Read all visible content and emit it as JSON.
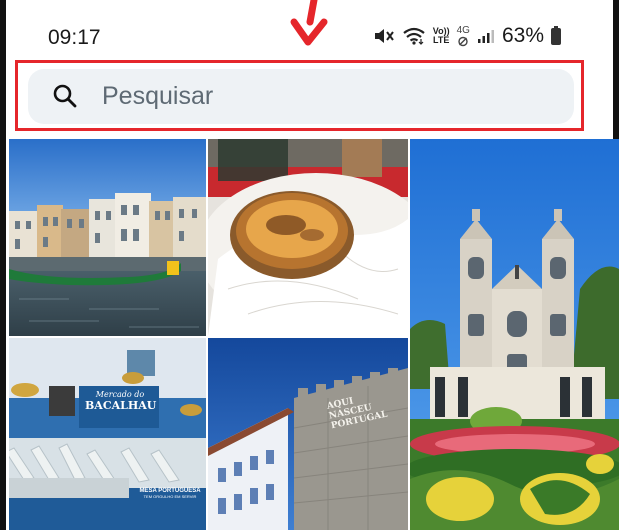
{
  "status_bar": {
    "time": "09:17",
    "volte_top": "Vo))",
    "volte_bottom": "LTE",
    "network_top": "4G",
    "battery_percent": "63%",
    "icons": [
      "mute-icon",
      "wifi-icon",
      "volte-icon",
      "no-data-icon",
      "signal-icon",
      "battery-icon"
    ]
  },
  "search": {
    "placeholder": "Pesquisar",
    "highlight_color": "#e5262b"
  },
  "annotation": {
    "arrow_color": "#e5262b"
  },
  "photos": [
    {
      "name": "photo-aveiro-canal",
      "subject": "canal with moliceiro boat and colorful facades"
    },
    {
      "name": "photo-pastel-de-nata",
      "subject": "custard tart on napkin"
    },
    {
      "name": "photo-bom-jesus",
      "subject": "baroque church with twin towers and gardens"
    },
    {
      "name": "photo-fish-market",
      "subject": "cod shop interior"
    },
    {
      "name": "photo-castle-wall",
      "subject": "stone wall with tiled house"
    }
  ],
  "photo_captions": {
    "bacalhau_sign_top": "Mercado do",
    "bacalhau_sign_bottom": "BACALHAU",
    "mesa_sign_top": "MESA PORTUGUESA",
    "mesa_sign_bottom": "TEM ORGULHO EM SERVIR",
    "wall_line1": "AQUI",
    "wall_line2": "NASCEU",
    "wall_line3": "PORTUGAL"
  }
}
